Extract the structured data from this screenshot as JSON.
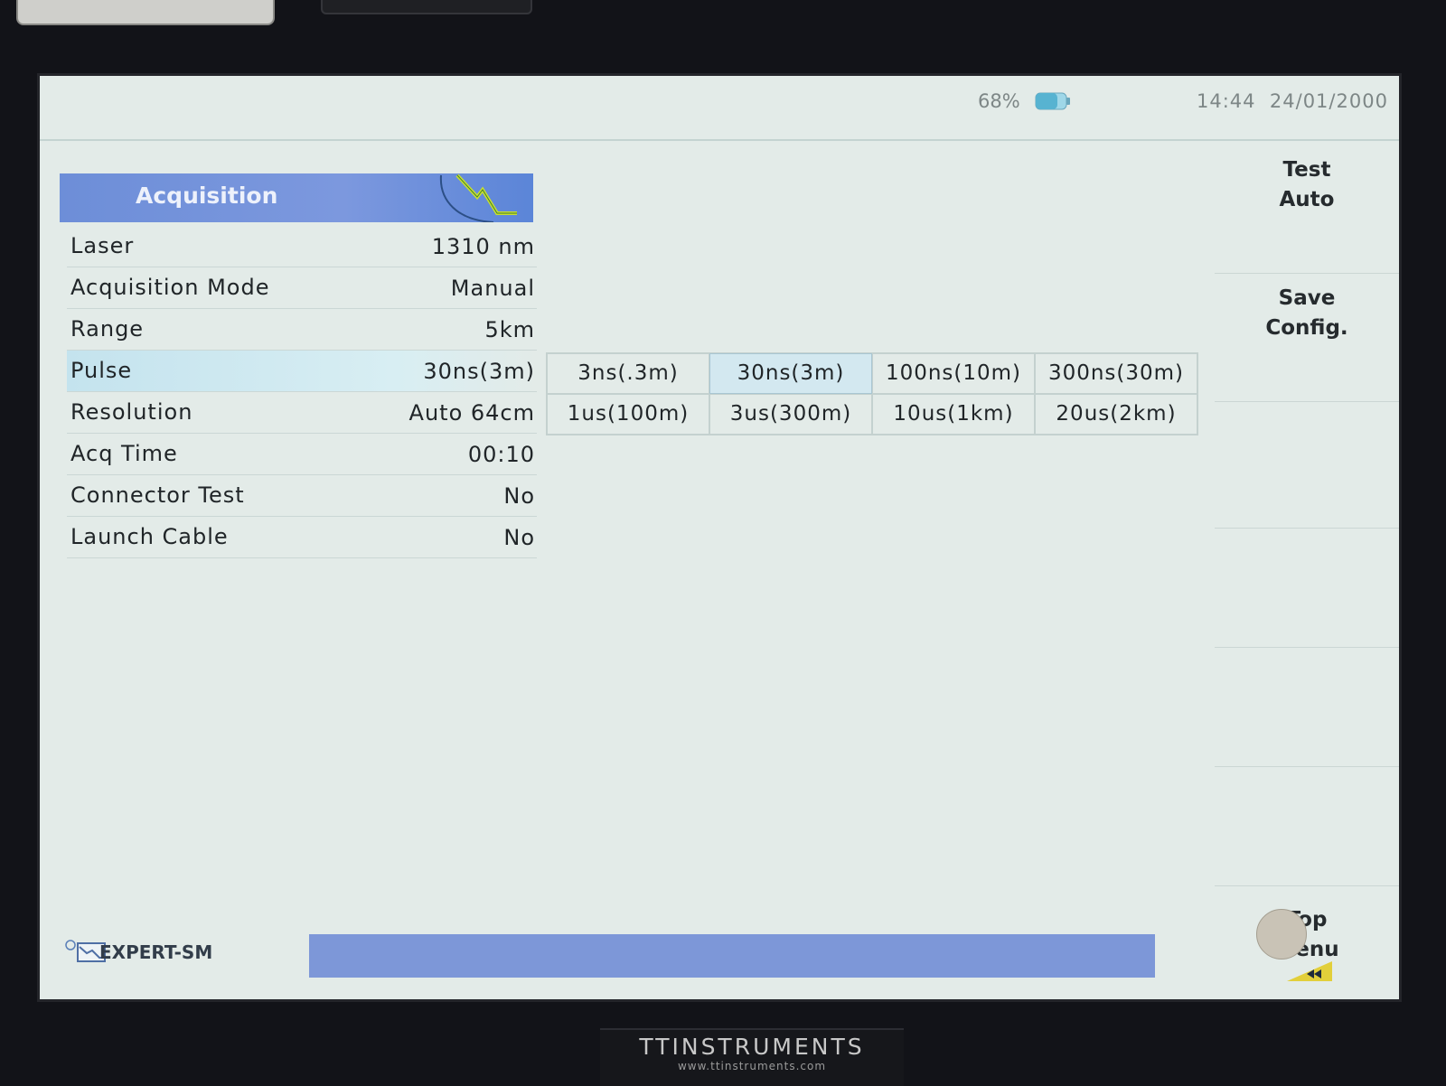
{
  "status": {
    "battery": "68%",
    "time": "14:44",
    "date": "24/01/2000"
  },
  "acquisition": {
    "title": "Acquisition",
    "params": [
      {
        "label": "Laser",
        "value": "1310 nm"
      },
      {
        "label": "Acquisition Mode",
        "value": "Manual"
      },
      {
        "label": "Range",
        "value": "5km"
      },
      {
        "label": "Pulse",
        "value": "30ns(3m)"
      },
      {
        "label": "Resolution",
        "value": "Auto 64cm"
      },
      {
        "label": "Acq Time",
        "value": "00:10"
      },
      {
        "label": "Connector Test",
        "value": "No"
      },
      {
        "label": "Launch Cable",
        "value": "No"
      }
    ],
    "selected_param": "Pulse"
  },
  "pulse_options": {
    "items": [
      "3ns(.3m)",
      "30ns(3m)",
      "100ns(10m)",
      "300ns(30m)",
      "1us(100m)",
      "3us(300m)",
      "10us(1km)",
      "20us(2km)"
    ],
    "selected": "30ns(3m)"
  },
  "softkeys": {
    "test_auto": {
      "line1": "Test",
      "line2": "Auto"
    },
    "save_config": {
      "line1": "Save",
      "line2": "Config."
    },
    "top_menu": {
      "line1": "Top",
      "line2": "Menu"
    }
  },
  "footer": {
    "mode": "EXPERT-SM"
  },
  "brand": {
    "name": "TTINSTRUMENTS",
    "url": "www.ttinstruments.com"
  },
  "colors": {
    "screen_bg": "#e3ebe8",
    "header_blue": "#6d8ed8",
    "footer_blue": "#7d97d8",
    "selected_row": "#c4e3ee",
    "bezel": "#121318"
  },
  "icons": [
    "battery-icon",
    "trace-icon",
    "mode-icon",
    "back-arrow-icon"
  ]
}
